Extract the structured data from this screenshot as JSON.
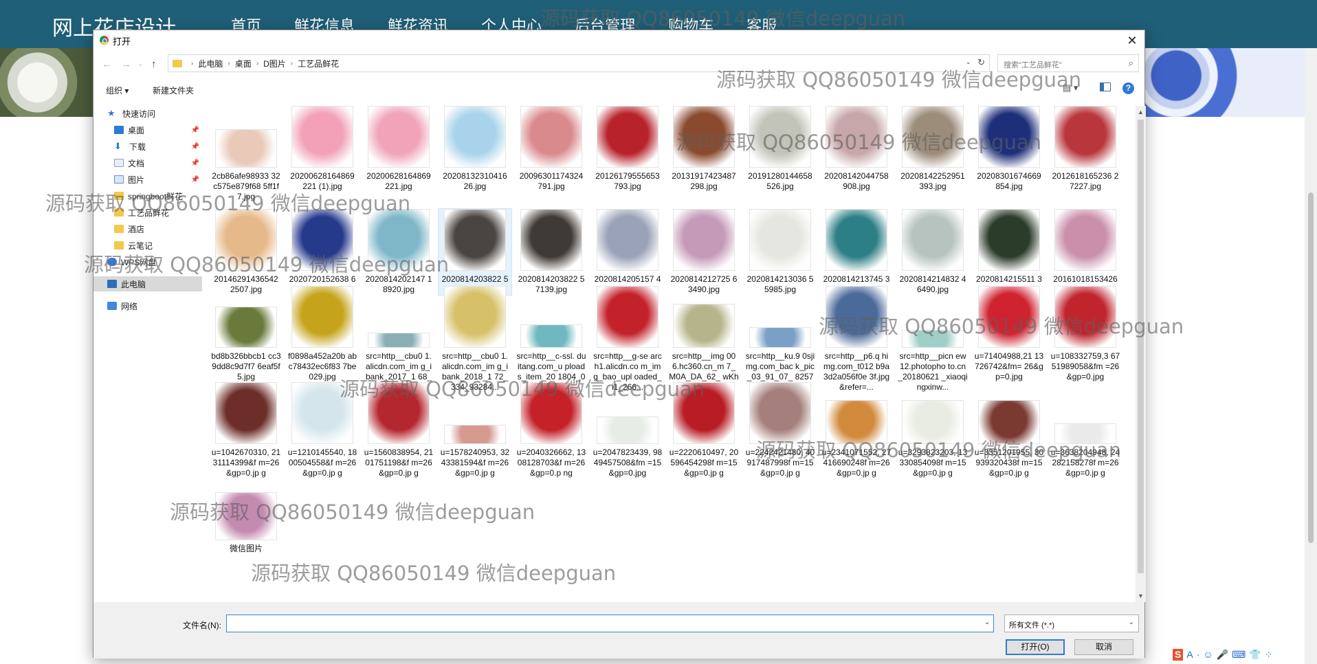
{
  "site": {
    "logo": "网上花店设计",
    "nav": [
      "首页",
      "鲜花信息",
      "鲜花资讯",
      "个人中心",
      "后台管理",
      "购物车",
      "客服"
    ]
  },
  "dialog": {
    "title": "打开",
    "close": "✕",
    "breadcrumb": [
      "此电脑",
      "桌面",
      "D图片",
      "工艺品鲜花"
    ],
    "search_placeholder": "搜索\"工艺品鲜花\"",
    "toolbar": {
      "organize": "组织 ▾",
      "new_folder": "新建文件夹",
      "help": "?"
    },
    "nav_items": [
      {
        "label": "快速访问",
        "icon": "star-icon",
        "pinned": false
      },
      {
        "label": "桌面",
        "icon": "desktop-icon",
        "pinned": true
      },
      {
        "label": "下载",
        "icon": "download-icon",
        "pinned": true
      },
      {
        "label": "文档",
        "icon": "document-icon",
        "pinned": true
      },
      {
        "label": "图片",
        "icon": "picture-icon",
        "pinned": true
      },
      {
        "label": "springboot鲜花",
        "icon": "folder-icon",
        "pinned": false
      },
      {
        "label": "工艺品鲜花",
        "icon": "folder-icon",
        "pinned": false
      },
      {
        "label": "酒店",
        "icon": "folder-icon",
        "pinned": false
      },
      {
        "label": "云笔记",
        "icon": "folder-icon",
        "pinned": false
      },
      {
        "label": "WPS网盘",
        "icon": "cloud-icon",
        "pinned": false
      },
      {
        "label": "此电脑",
        "icon": "computer-icon",
        "pinned": false,
        "selected": true
      },
      {
        "label": "网络",
        "icon": "network-icon",
        "pinned": false
      }
    ],
    "files": [
      [
        "2cb86afe98933 32c575e879f68 5ff1f7.jpg",
        "20200628164869 221 (1).jpg",
        "20200628164869 221.jpg",
        "20208132310416 26.jpg",
        "20096301174324 791.jpg",
        "20126179555653 793.jpg",
        "20131917423487 298.jpg",
        "20191280144658 526.jpg",
        "20208142044758 908.jpg",
        "20208142252951 393.jpg",
        "20208301674669 854.jpg",
        "2012618165236 27227.jpg"
      ],
      [
        "20146291436542 2507.jpg",
        "2020720152638 69660.jpg",
        "2020814202147 18920.jpg",
        "2020814203822 57139 (1).jpg",
        "2020814203822 57139.jpg",
        "2020814205157 43852.jpg",
        "2020814212725 63490.jpg",
        "2020814213036 55985.jpg",
        "2020814213745 39037.jpg",
        "2020814214832 46490.jpg",
        "2020814215511 30564.jpg",
        "20161018153426 15220.jpg"
      ],
      [
        "bd8b326bbcb1 cc39dd8c9d7f7 6eaf5f5.jpg",
        "f0898a452a20b abc78432ec6f83 7be029.jpg",
        "src=http__cbu0 1.alicdn.com_im g_ibank_2017_1 68_813_48573...",
        "src=http__cbu0 1.alicdn.com_im g_ibank_2018_1 72_334_93284...",
        "src=http__c-ssl. duitang.com_u ploads_item_20 1804_01_2018...",
        "src=http__g-se arch1.alicdn.co m_img_bao_upl oaded_i1_266...",
        "src=http__img 006.hc360.cn_m 7_M0A_DA_62_ wKhQpFV-np...",
        "src=http__ku.9 0sjimg.com_bac k_pic_03_91_07_ 8257dea1294...",
        "src=http__p6.q himg.com_t012 b9a3d2a056f0e 3f.jpg&refer=...",
        "src=http__picn ew12.photopho to.cn_20180621 _xiaoqingxinw...",
        "u=71404988,21 13726742&fm= 26&gp=0.jpg",
        "u=108332759,3 6751989058&fm =26&gp=0.jpg"
      ],
      [
        "u=1042670310, 2131114399&f m=26&gp=0.jp g",
        "u=1210145540, 1800504558&f m=26&gp=0.jp g",
        "u=1560838954, 2101751198&f m=26&gp=0.jp g",
        "u=1578240953, 3243381594&f m=26&gp=0.jp g",
        "u=2040326662, 1308128703&f m=26&gp=0.p ng",
        "u=2047823439, 9849457508&fm =15&gp=0.jpg",
        "u=2220610497, 20596454298f m=15&gp=0.jp g",
        "u=2242421480, 40917487998f m=15&gp=0.jp g",
        "u=2341071552, 27416690248f m=26&gp=0.jp g",
        "u=3293823203, 13330854098f m=15&gp=0.jp g",
        "u=3351201955, 30939320438f m=15&gp=0.jp g",
        "u=3638204948, 24282158278f m=26&gp=0.jp g"
      ],
      [
        "微信图片"
      ]
    ],
    "thumb_colors": [
      [
        "#e9c9b8",
        "#f2a1b8",
        "#f0a3b9",
        "#a8d3ea",
        "#d98a8d",
        "#b8232b",
        "#8a4a2e",
        "#c2c4b9",
        "#c7a7a9",
        "#9c8c7a",
        "#1e2f7a",
        "#b8363c"
      ],
      [
        "#e6b98a",
        "#263a8c",
        "#7fb7c9",
        "#4b4541",
        "#3f3a35",
        "#9aa2b8",
        "#c59ab8",
        "#e6e6e0",
        "#2d7f86",
        "#b7c3be",
        "#2c3c2a",
        "#c98fab"
      ],
      [
        "#6a7a3a",
        "#c5a31b",
        "#8ab0b6",
        "#d6c068",
        "#6fb8c0",
        "#c3222b",
        "#b6b48a",
        "#7aa0c8",
        "#4a6a9a",
        "#a0cfc8",
        "#cf2330",
        "#c0252e"
      ],
      [
        "#6d2e2a",
        "#d4e6ec",
        "#b5272f",
        "#d69a90",
        "#c42129",
        "#e7ece7",
        "#b81c24",
        "#a47f7b",
        "#d28a3d",
        "#e9ece2",
        "#7a3a32",
        "#eaeaea"
      ],
      [
        "#c48ab0"
      ]
    ],
    "filename_label": "文件名(N):",
    "filename_value": "",
    "filter_value": "所有文件 (*.*)",
    "open_label": "打开(O)",
    "cancel_label": "取消"
  },
  "watermarks": [
    "源码获取 QQ86050149 微信deepguan",
    "源码获取 QQ86050149 微信deepguan",
    "源码获取 QQ86050149 微信deepguan",
    "源码获取 QQ86050149 微信deepguan",
    "源码获取 QQ86050149 微信deepguan",
    "源码获取 QQ86050149 微信deepguan",
    "源码获取 QQ86050149 微信deepguan",
    "源码获取 QQ86050149 微信deepguan",
    "源码获取 QQ86050149 微信deepguan",
    "源码获取 QQ86050149 微信deepguan"
  ],
  "ime": [
    "S",
    "A",
    "·",
    "☺",
    "🎤",
    "⌨",
    "👕",
    "⁘"
  ]
}
